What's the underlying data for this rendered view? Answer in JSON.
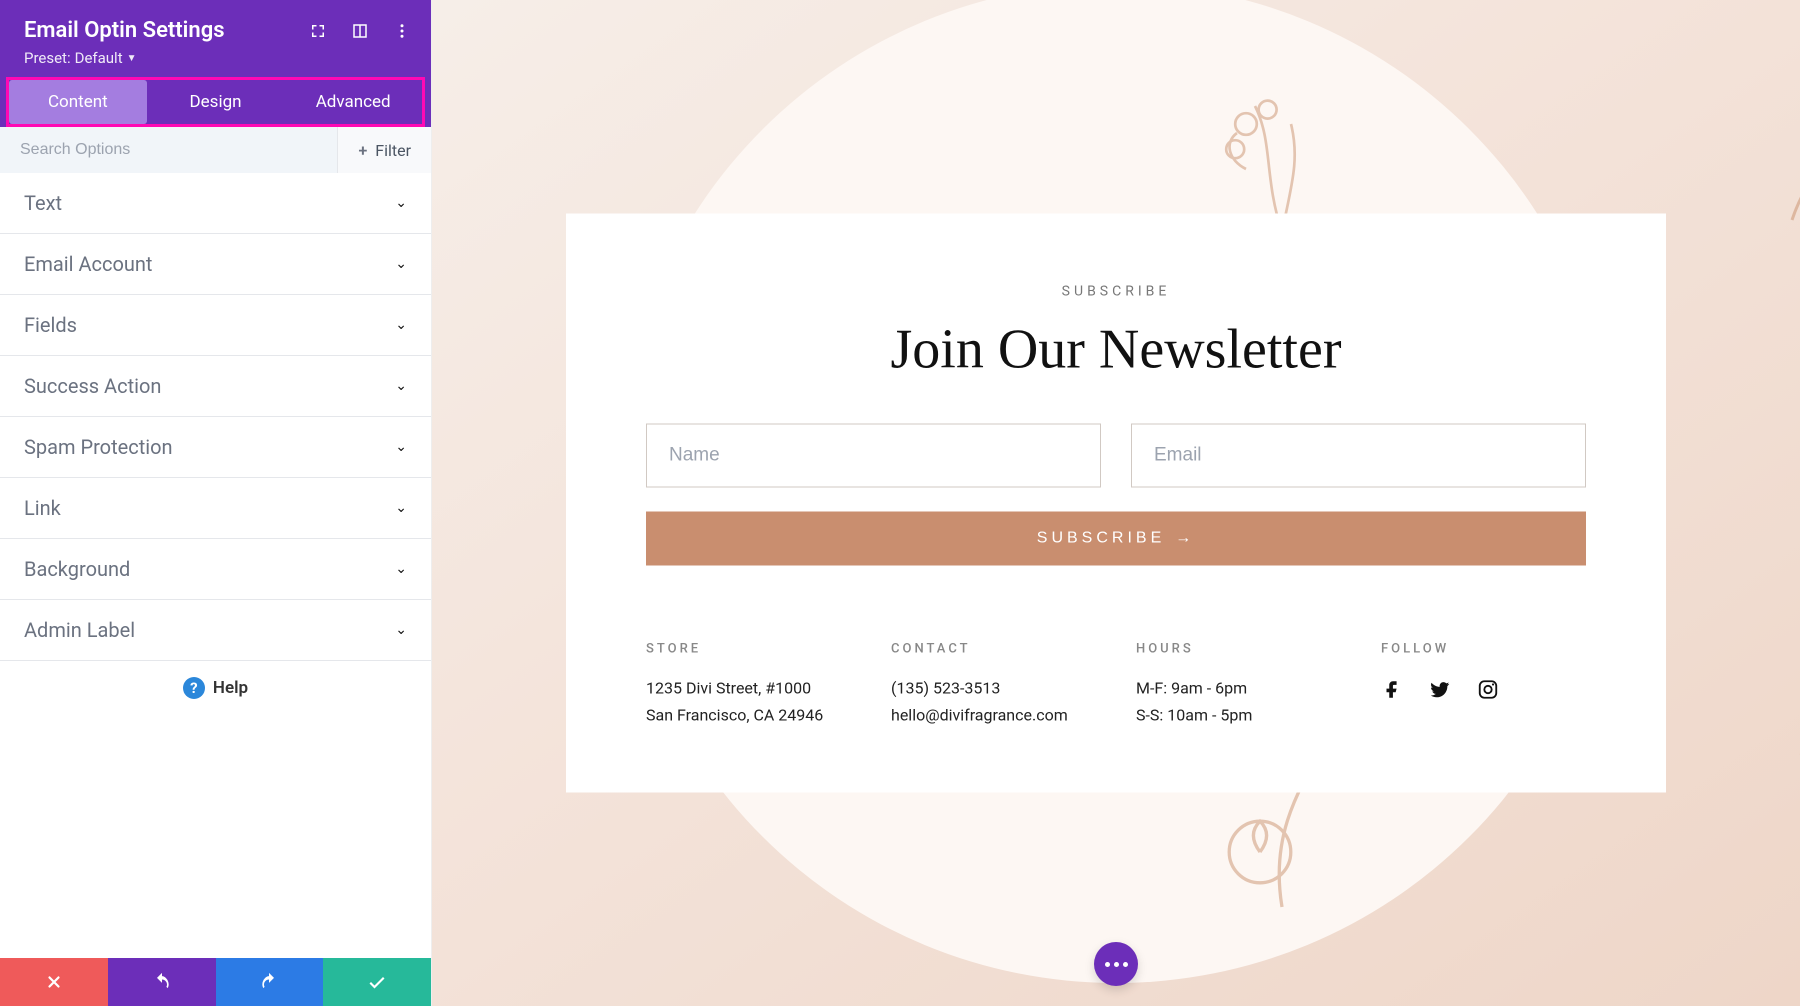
{
  "panel": {
    "title": "Email Optin Settings",
    "preset_label": "Preset:",
    "preset_value": "Default"
  },
  "tabs": [
    {
      "label": "Content",
      "active": true
    },
    {
      "label": "Design",
      "active": false
    },
    {
      "label": "Advanced",
      "active": false
    }
  ],
  "search": {
    "placeholder": "Search Options"
  },
  "filter": {
    "label": "Filter",
    "plus": "+"
  },
  "sections": [
    {
      "label": "Text"
    },
    {
      "label": "Email Account"
    },
    {
      "label": "Fields"
    },
    {
      "label": "Success Action"
    },
    {
      "label": "Spam Protection"
    },
    {
      "label": "Link"
    },
    {
      "label": "Background"
    },
    {
      "label": "Admin Label"
    }
  ],
  "help": {
    "label": "Help"
  },
  "newsletter": {
    "kicker": "SUBSCRIBE",
    "title": "Join Our Newsletter",
    "name_placeholder": "Name",
    "email_placeholder": "Email",
    "button": "SUBSCRIBE",
    "button_arrow": "→"
  },
  "info": {
    "store": {
      "heading": "STORE",
      "line1": "1235 Divi Street, #1000",
      "line2": "San Francisco, CA 24946"
    },
    "contact": {
      "heading": "CONTACT",
      "line1": "(135) 523-3513",
      "line2": "hello@divifragrance.com"
    },
    "hours": {
      "heading": "HOURS",
      "line1": "M-F: 9am - 6pm",
      "line2": "S-S: 10am - 5pm"
    },
    "follow": {
      "heading": "FOLLOW"
    }
  },
  "colors": {
    "accent": "#6c2eb9",
    "highlight": "#ff08b4",
    "subscribe": "#c98e6f"
  }
}
